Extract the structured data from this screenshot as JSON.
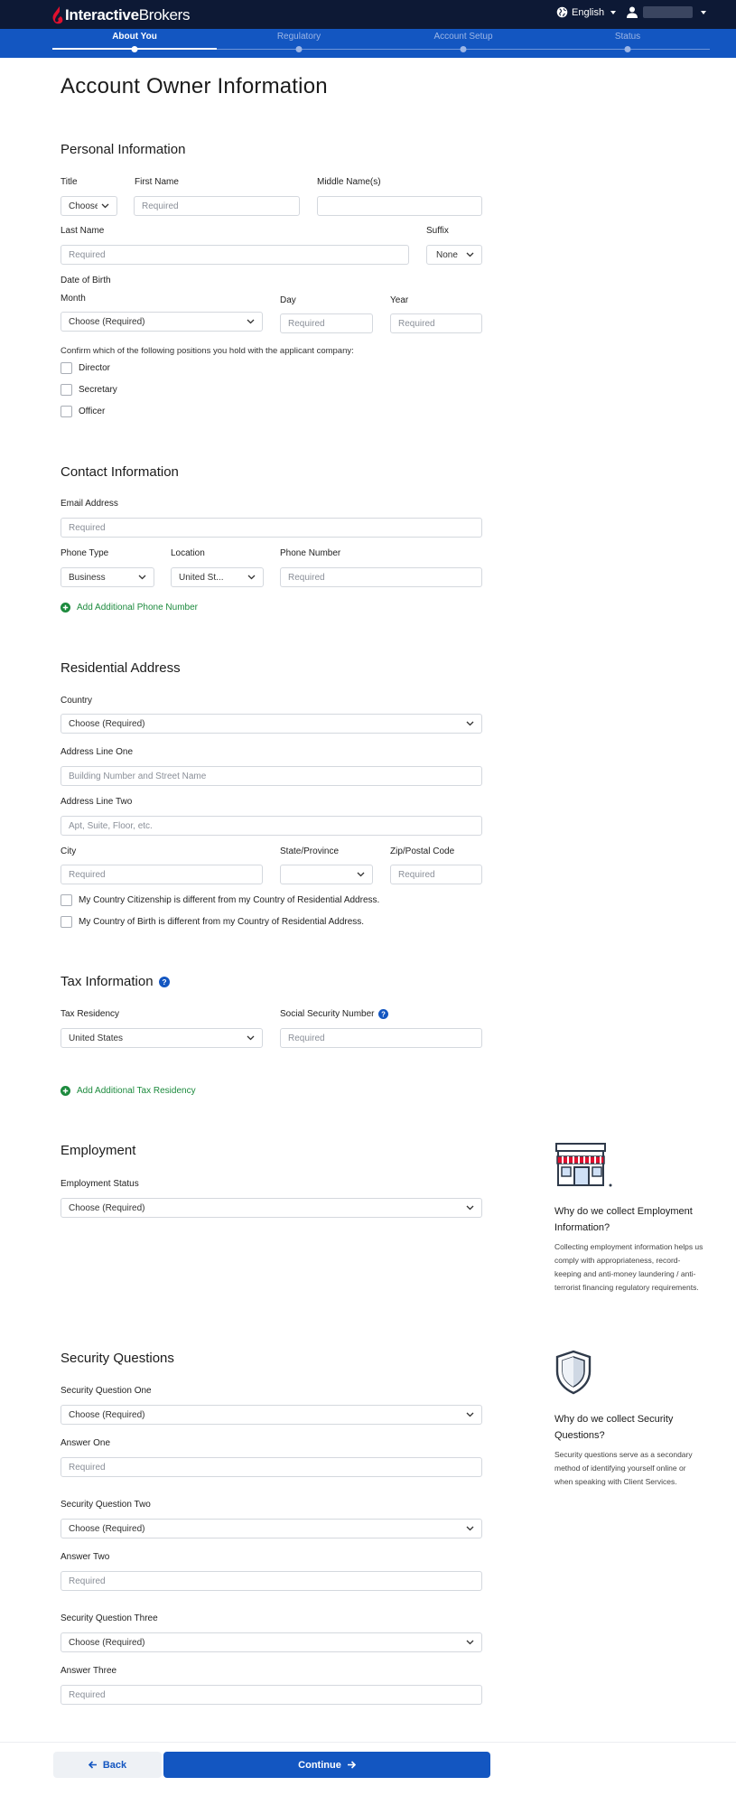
{
  "header": {
    "brand_bold": "Interactive",
    "brand_light": "Brokers",
    "language": "English",
    "colors": {
      "topbar": "#0d1935",
      "stepsbar": "#1356c1",
      "link_green": "#1c8a3d"
    }
  },
  "steps": [
    {
      "label": "About You",
      "active": true
    },
    {
      "label": "Regulatory",
      "active": false
    },
    {
      "label": "Account Setup",
      "active": false
    },
    {
      "label": "Status",
      "active": false
    }
  ],
  "page_title": "Account Owner Information",
  "personal": {
    "title": "Personal Information",
    "title_label": "Title",
    "title_select": "Choose",
    "first_name_label": "First Name",
    "first_name_placeholder": "Required",
    "middle_name_label": "Middle Name(s)",
    "last_name_label": "Last Name",
    "last_name_placeholder": "Required",
    "suffix_label": "Suffix",
    "suffix_select": "None",
    "dob_label": "Date of Birth",
    "month_label": "Month",
    "month_select": "Choose (Required)",
    "day_label": "Day",
    "day_placeholder": "Required",
    "year_label": "Year",
    "year_placeholder": "Required",
    "positions_note": "Confirm which of the following positions you hold with the applicant company:",
    "positions": [
      "Director",
      "Secretary",
      "Officer"
    ]
  },
  "contact": {
    "title": "Contact Information",
    "email_label": "Email Address",
    "email_placeholder": "Required",
    "phone_type_label": "Phone Type",
    "phone_type_select": "Business",
    "location_label": "Location",
    "location_select": "United St...",
    "phone_number_label": "Phone Number",
    "phone_number_placeholder": "Required",
    "add_phone": "Add Additional Phone Number"
  },
  "residential": {
    "title": "Residential Address",
    "country_label": "Country",
    "country_select": "Choose (Required)",
    "line1_label": "Address Line One",
    "line1_placeholder": "Building Number and Street Name",
    "line2_label": "Address Line Two",
    "line2_placeholder": "Apt, Suite, Floor, etc.",
    "city_label": "City",
    "city_placeholder": "Required",
    "state_label": "State/Province",
    "state_select": "",
    "zip_label": "Zip/Postal Code",
    "zip_placeholder": "Required",
    "citizenship_check": "My Country Citizenship is different from my Country of Residential Address.",
    "birth_check": "My Country of Birth is different from my Country of Residential Address."
  },
  "tax": {
    "title": "Tax Information",
    "residency_label": "Tax Residency",
    "residency_select": "United States",
    "ssn_label": "Social Security Number",
    "ssn_placeholder": "Required",
    "add_residency": "Add Additional Tax Residency"
  },
  "employment": {
    "title": "Employment",
    "status_label": "Employment Status",
    "status_select": "Choose (Required)",
    "side_title": "Why do we collect Employment Information?",
    "side_text": "Collecting employment information helps us comply with appropriateness, record-keeping and anti-money laundering / anti-terrorist financing regulatory requirements."
  },
  "security": {
    "title": "Security Questions",
    "q1_label": "Security Question One",
    "q1_select": "Choose (Required)",
    "a1_label": "Answer One",
    "a1_placeholder": "Required",
    "q2_label": "Security Question Two",
    "q2_select": "Choose (Required)",
    "a2_label": "Answer Two",
    "a2_placeholder": "Required",
    "q3_label": "Security Question Three",
    "q3_select": "Choose (Required)",
    "a3_label": "Answer Three",
    "a3_placeholder": "Required",
    "side_title": "Why do we collect Security Questions?",
    "side_text": "Security questions serve as a secondary method of identifying yourself online or when speaking with Client Services."
  },
  "footer": {
    "back": "Back",
    "continue": "Continue"
  }
}
